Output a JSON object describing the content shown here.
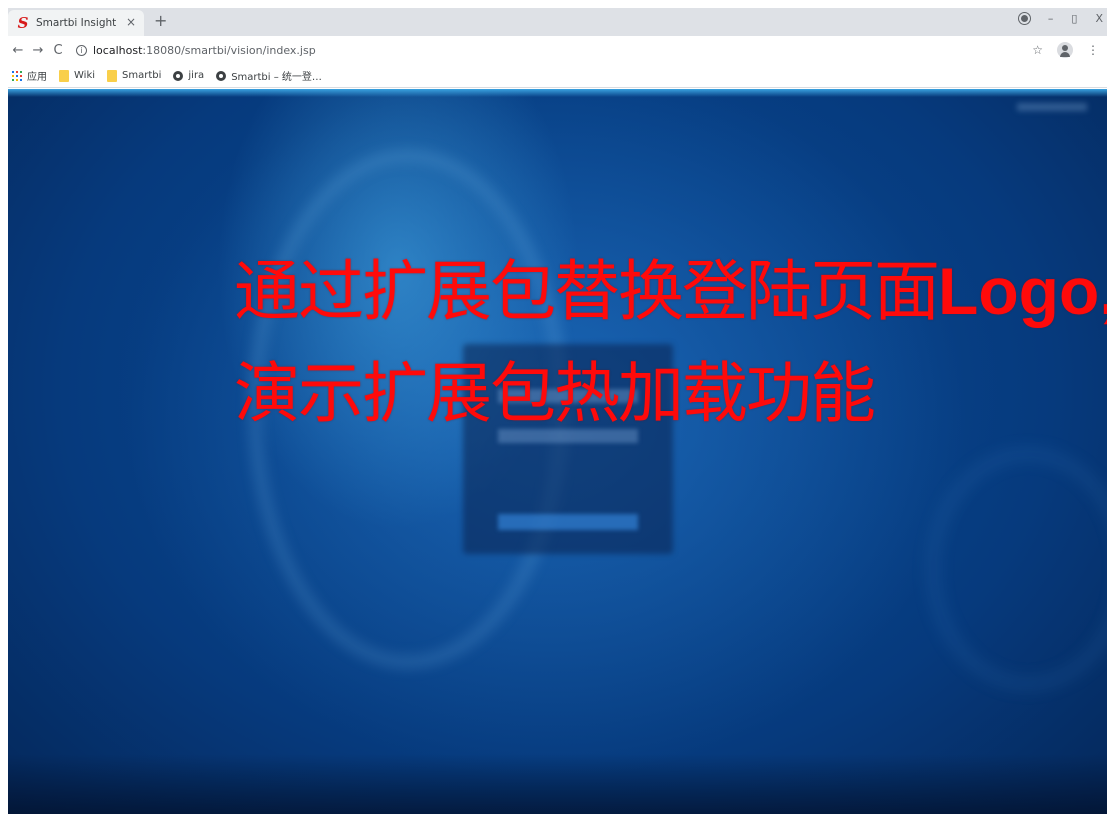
{
  "browser": {
    "tab": {
      "logo": "S",
      "title": "Smartbi Insight",
      "close": "×"
    },
    "new_tab": "+",
    "window_controls": {
      "minimize": "–",
      "restore": "▯",
      "close": "X"
    },
    "nav": {
      "back": "←",
      "forward": "→",
      "reload": "C"
    },
    "address": {
      "info": "i",
      "host": "localhost",
      "path": ":18080/smartbi/vision/index.jsp"
    },
    "toolbar_right": {
      "star": "☆",
      "menu": "⋮"
    },
    "bookmarks": [
      {
        "label": "应用",
        "icon": "apps-grid-icon"
      },
      {
        "label": "Wiki",
        "icon": "folder-icon"
      },
      {
        "label": "Smartbi",
        "icon": "folder-icon"
      },
      {
        "label": "jira",
        "icon": "globe-icon"
      },
      {
        "label": "Smartbi – 统一登…",
        "icon": "globe-icon"
      }
    ]
  },
  "page": {
    "overlay": {
      "line1_cn": "通过扩展包替换登陆页面",
      "line1_latin": "Logo,",
      "line2": "演示扩展包热加载功能"
    },
    "colors": {
      "overlay_text": "#ff0a0a",
      "background": "#0b4f9c"
    }
  }
}
